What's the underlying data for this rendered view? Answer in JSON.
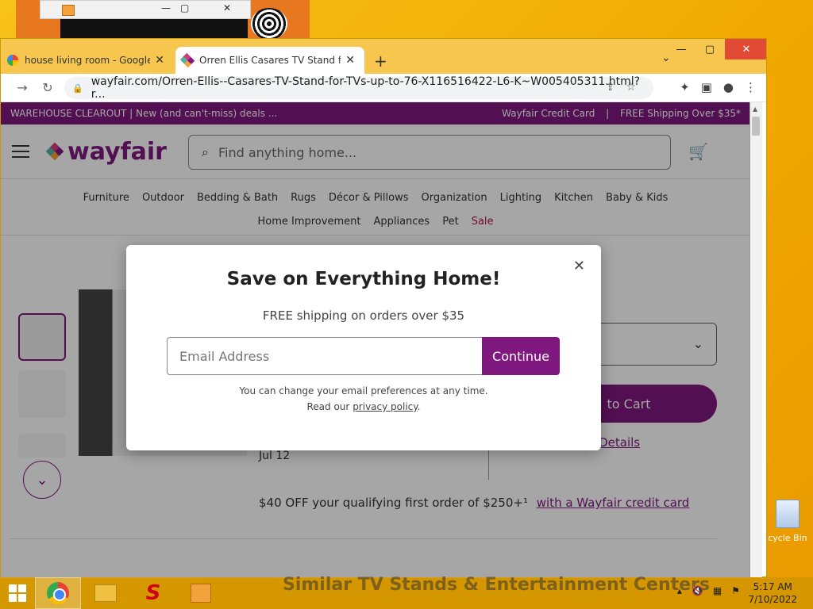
{
  "browser": {
    "tabs": [
      {
        "title": "house living room - Google Sear",
        "close": "✕"
      },
      {
        "title": "Orren Ellis Casares TV Stand for T",
        "close": "✕"
      }
    ],
    "new_tab": "+",
    "tab_menu": "⌄",
    "window_controls": {
      "minimize": "—",
      "maximize": "▢",
      "close": "✕"
    },
    "url": "wayfair.com/Orren-Ellis--Casares-TV-Stand-for-TVs-up-to-76-X116516422-L6-K~W005405311.html?r..."
  },
  "page": {
    "promo_left": "WAREHOUSE CLEAROUT | New (and can't-miss) deals ...",
    "promo_right": [
      "Wayfair Credit Card",
      "|",
      "FREE Shipping Over $35*"
    ],
    "logo": "wayfair",
    "search_placeholder": "Find anything home...",
    "nav_row1": [
      "Furniture",
      "Outdoor",
      "Bedding & Bath",
      "Rugs",
      "Décor & Pillows",
      "Organization",
      "Lighting",
      "Kitchen",
      "Baby & Kids"
    ],
    "nav_row2": [
      "Home Improvement",
      "Appliances",
      "Pet",
      "Sale"
    ],
    "add_to_cart": "to Cart",
    "details_link": "ll Details",
    "delivery_date": "Jul 12",
    "offer_text": "$40 OFF your qualifying first order of $250+¹",
    "offer_link": "with a Wayfair credit card",
    "similar_heading": "Similar TV Stands & Entertainment Centers"
  },
  "modal": {
    "title": "Save on Everything Home!",
    "subtitle": "FREE shipping on orders over $35",
    "email_placeholder": "Email Address",
    "continue_label": "Continue",
    "fine1": "You can change your email preferences at any time.",
    "fine2_prefix": "Read our",
    "privacy_link": "privacy policy",
    "fine2_suffix": "."
  },
  "desktop": {
    "recycle_label": "cycle Bin"
  },
  "taskbar": {
    "time": "5:17 AM",
    "date": "7/10/2022"
  },
  "colors": {
    "brand": "#7f187f",
    "sale": "#b3124b"
  }
}
